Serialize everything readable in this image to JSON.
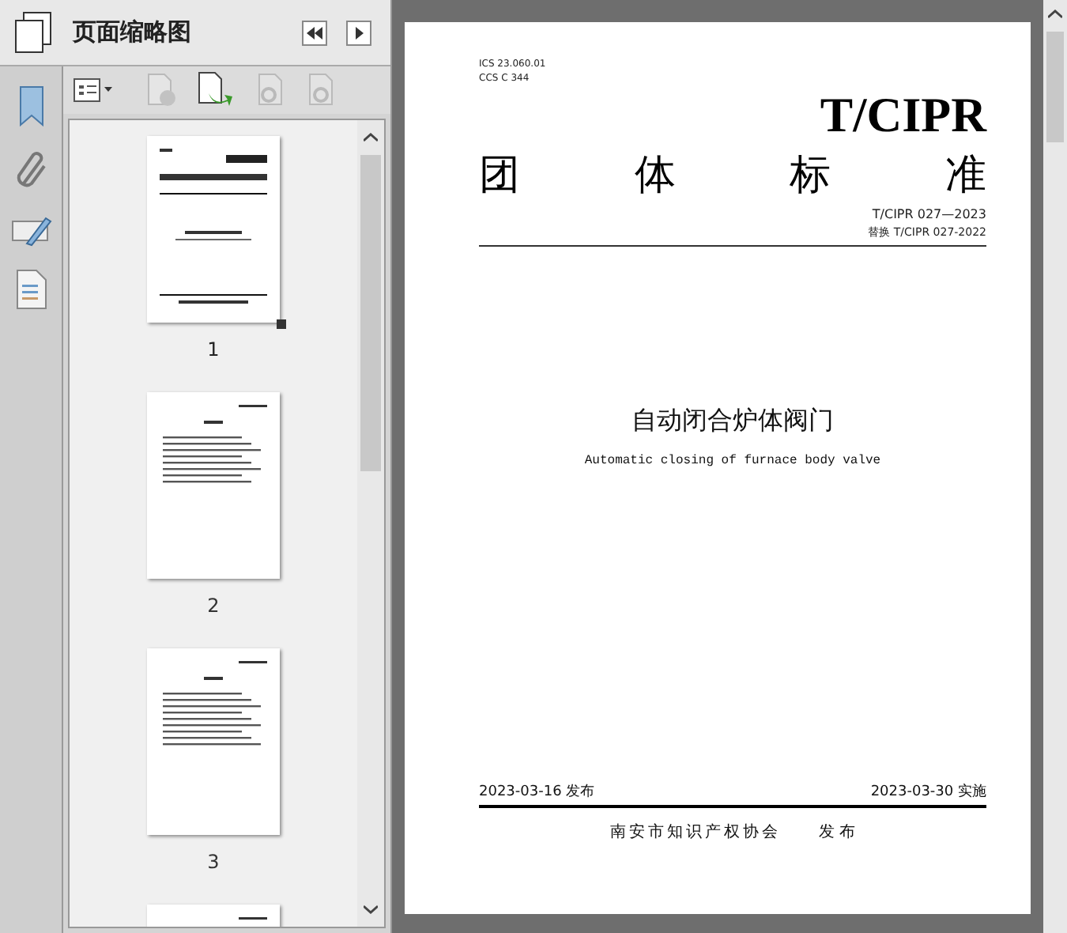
{
  "panel": {
    "title": "页面缩略图"
  },
  "thumbnails": [
    {
      "label": "1",
      "selected": true
    },
    {
      "label": "2",
      "selected": false
    },
    {
      "label": "3",
      "selected": false
    }
  ],
  "document": {
    "classification": [
      "ICS 23.060.01",
      "CCS C 344"
    ],
    "org_code": "T/CIPR",
    "heading": [
      "团",
      "体",
      "标",
      "准"
    ],
    "number": "T/CIPR 027—2023",
    "replaces": "替换 T/CIPR 027-2022",
    "title": "自动闭合炉体阀门",
    "title_en": "Automatic closing of furnace body valve",
    "published": "2023-03-16 发布",
    "effective": "2023-03-30 实施",
    "publisher": "南安市知识产权协会",
    "publisher_action": "发 布"
  }
}
